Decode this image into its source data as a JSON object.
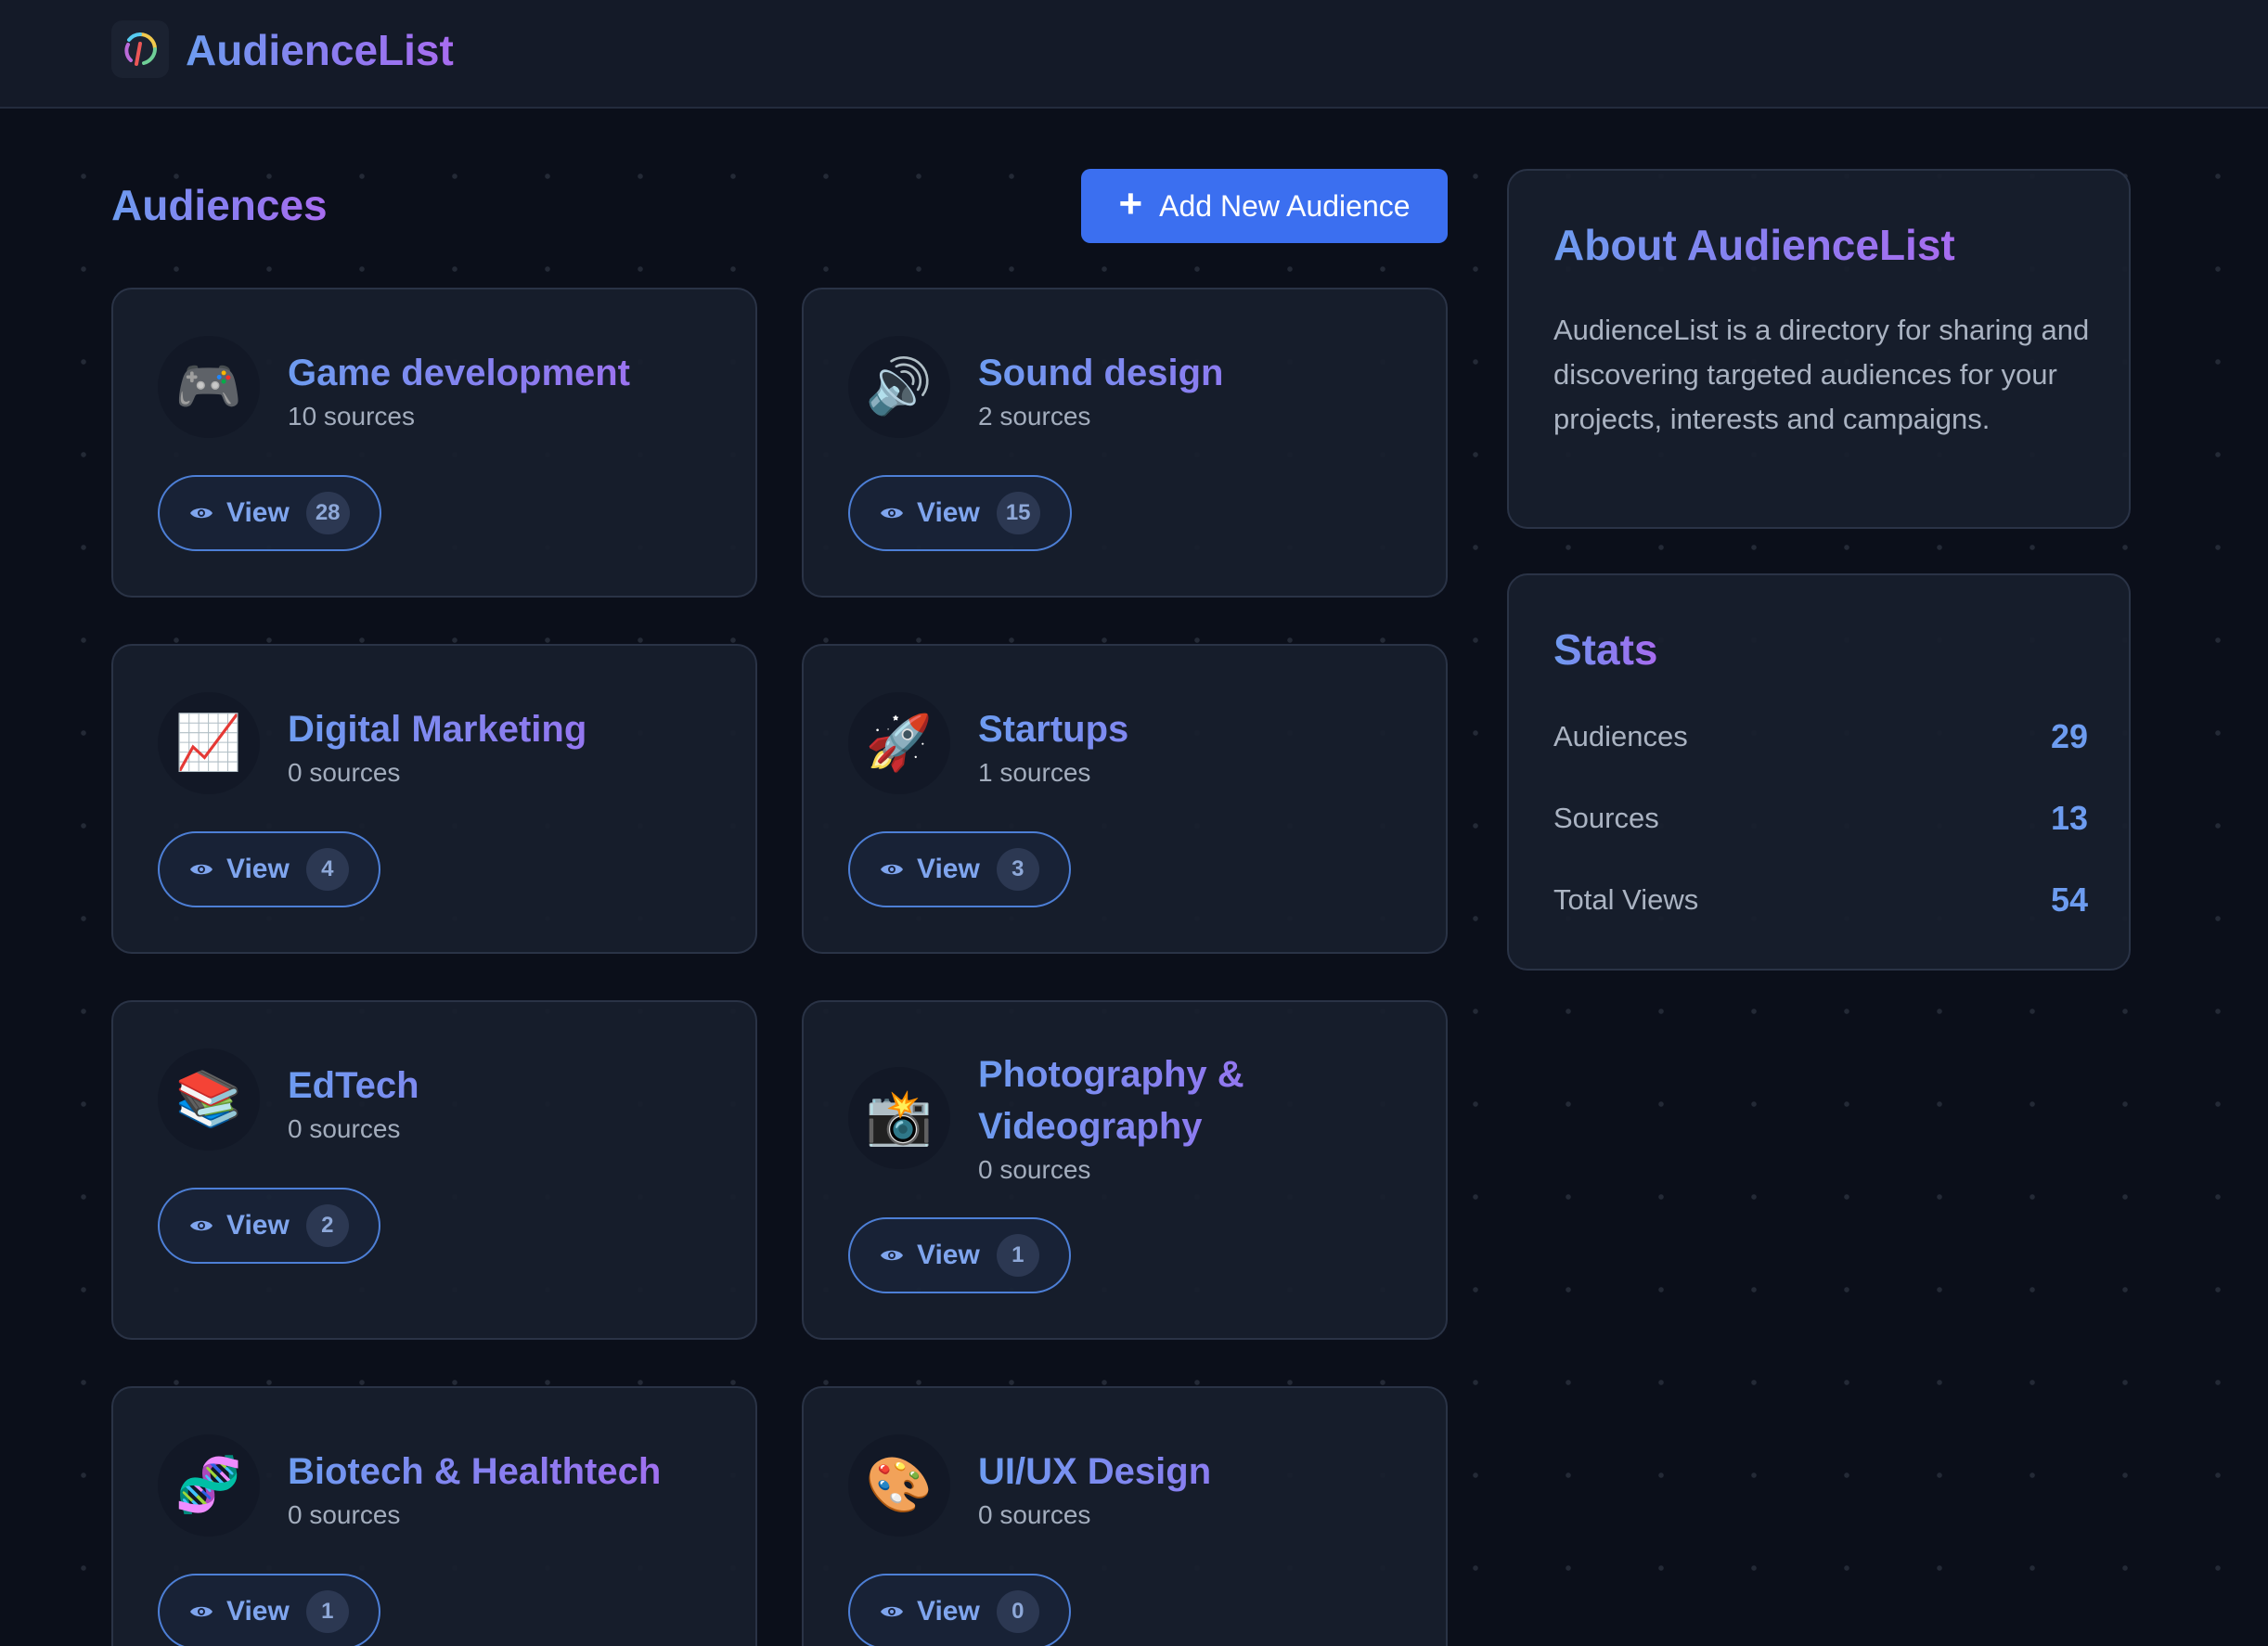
{
  "header": {
    "brand": "AudienceList",
    "logo_icon": "circular-arcs-logo-icon"
  },
  "main": {
    "title": "Audiences",
    "add_button_label": "Add New Audience",
    "view_label": "View",
    "cards": [
      {
        "icon": "🎮",
        "icon_name": "game-controller-icon",
        "name": "Game development",
        "sources": "10 sources",
        "views": "28"
      },
      {
        "icon": "🔊",
        "icon_name": "speaker-icon",
        "name": "Sound design",
        "sources": "2 sources",
        "views": "15"
      },
      {
        "icon": "📈",
        "icon_name": "chart-increasing-icon",
        "name": "Digital Marketing",
        "sources": "0 sources",
        "views": "4"
      },
      {
        "icon": "🚀",
        "icon_name": "rocket-icon",
        "name": "Startups",
        "sources": "1 sources",
        "views": "3"
      },
      {
        "icon": "📚",
        "icon_name": "books-icon",
        "name": "EdTech",
        "sources": "0 sources",
        "views": "2"
      },
      {
        "icon": "📸",
        "icon_name": "camera-flash-icon",
        "name": "Photography & Videography",
        "sources": "0 sources",
        "views": "1"
      },
      {
        "icon": "🧬",
        "icon_name": "dna-icon",
        "name": "Biotech & Healthtech",
        "sources": "0 sources",
        "views": "1"
      },
      {
        "icon": "🎨",
        "icon_name": "palette-icon",
        "name": "UI/UX Design",
        "sources": "0 sources",
        "views": "0"
      }
    ]
  },
  "sidebar": {
    "about": {
      "title": "About AudienceList",
      "text": "AudienceList is a directory for sharing and discovering targeted audiences for your projects, interests and campaigns."
    },
    "stats": {
      "title": "Stats",
      "rows": [
        {
          "label": "Audiences",
          "value": "29"
        },
        {
          "label": "Sources",
          "value": "13"
        },
        {
          "label": "Total Views",
          "value": "54"
        }
      ]
    }
  },
  "colors": {
    "accent_blue": "#3b6ff0",
    "gradient_start": "#6d9cf0",
    "gradient_end": "#a86cf0",
    "background": "#0b0f1a"
  }
}
